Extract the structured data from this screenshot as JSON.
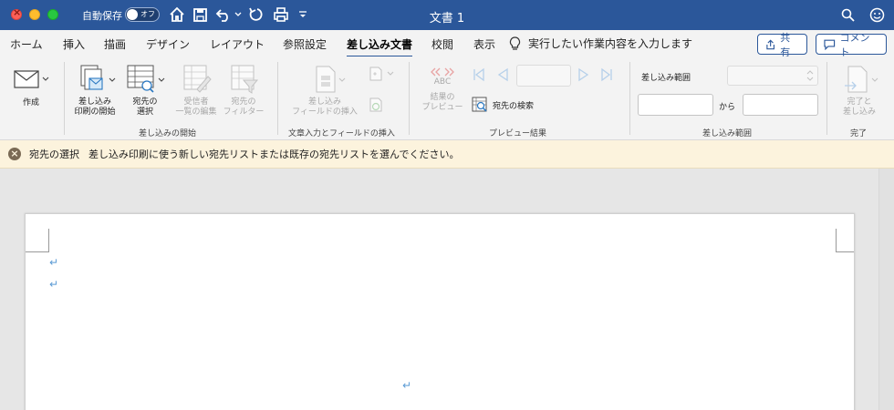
{
  "titlebar": {
    "autosave_label": "自動保存",
    "autosave_state": "オフ",
    "document_title": "文書 1"
  },
  "tabs": [
    {
      "label": "ホーム"
    },
    {
      "label": "挿入"
    },
    {
      "label": "描画"
    },
    {
      "label": "デザイン"
    },
    {
      "label": "レイアウト"
    },
    {
      "label": "参照設定"
    },
    {
      "label": "差し込み文書",
      "active": true
    },
    {
      "label": "校閲"
    },
    {
      "label": "表示"
    }
  ],
  "tell_me": "実行したい作業内容を入力します",
  "share_label": "共有",
  "comment_label": "コメント",
  "ribbon": {
    "create": {
      "label": "作成"
    },
    "start_mailmerge": {
      "line1": "差し込み",
      "line2": "印刷の開始"
    },
    "select_recipients": {
      "line1": "宛先の",
      "line2": "選択"
    },
    "edit_recipients": {
      "line1": "受信者",
      "line2": "一覧の編集"
    },
    "filter_recipients": {
      "line1": "宛先の",
      "line2": "フィルター"
    },
    "group1_label": "差し込みの開始",
    "insert_field": {
      "line1": "差し込み",
      "line2": "フィールドの挿入"
    },
    "group2_label": "文章入力とフィールドの挿入",
    "preview_results": {
      "line1": "結果の",
      "line2": "プレビュー"
    },
    "abc_text": "ABC",
    "find_recipient": "宛先の検索",
    "group3_label": "プレビュー結果",
    "merge_range_label": "差し込み範囲",
    "from_label": "から",
    "group4_label": "差し込み範囲",
    "finish_merge": {
      "line1": "完了と",
      "line2": "差し込み"
    },
    "group5_label": "完了"
  },
  "message_bar": {
    "title": "宛先の選択",
    "text": "差し込み印刷に使う新しい宛先リストまたは既存の宛先リストを選んでください。"
  },
  "paragraph_mark": "↵",
  "colors": {
    "titlebar": "#2b579a",
    "message_bar": "#fcf3dd",
    "paragraph_mark": "#5b9bd5"
  }
}
